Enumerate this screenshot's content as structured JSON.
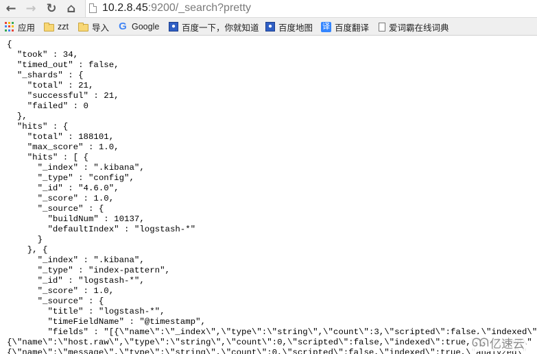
{
  "browser": {
    "nav": {
      "back_icon": "←",
      "forward_icon": "→",
      "reload_icon": "↻",
      "home_icon": "⌂"
    },
    "url": {
      "host": "10.2.8.45",
      "rest": ":9200/_search?pretty"
    },
    "bookmarks": [
      {
        "label": "应用",
        "icon": "apps-icon"
      },
      {
        "label": "zzt",
        "icon": "folder-icon"
      },
      {
        "label": "导入",
        "icon": "folder-icon"
      },
      {
        "label": "Google",
        "icon": "google-icon",
        "glyph": "G"
      },
      {
        "label": "百度一下，你就知道",
        "icon": "baidu-icon",
        "glyph": "🐾"
      },
      {
        "label": "百度地图",
        "icon": "baidu-icon",
        "glyph": "🐾"
      },
      {
        "label": "百度翻译",
        "icon": "translate-icon",
        "glyph": "译"
      },
      {
        "label": "爱词霸在线词典",
        "icon": "page-icon"
      }
    ]
  },
  "page": {
    "json_lines": [
      "{",
      "  \"took\" : 34,",
      "  \"timed_out\" : false,",
      "  \"_shards\" : {",
      "    \"total\" : 21,",
      "    \"successful\" : 21,",
      "    \"failed\" : 0",
      "  },",
      "  \"hits\" : {",
      "    \"total\" : 188101,",
      "    \"max_score\" : 1.0,",
      "    \"hits\" : [ {",
      "      \"_index\" : \".kibana\",",
      "      \"_type\" : \"config\",",
      "      \"_id\" : \"4.6.0\",",
      "      \"_score\" : 1.0,",
      "      \"_source\" : {",
      "        \"buildNum\" : 10137,",
      "        \"defaultIndex\" : \"logstash-*\"",
      "      }",
      "    }, {",
      "      \"_index\" : \".kibana\",",
      "      \"_type\" : \"index-pattern\",",
      "      \"_id\" : \"logstash-*\",",
      "      \"_score\" : 1.0,",
      "      \"_source\" : {",
      "        \"title\" : \"logstash-*\",",
      "        \"timeFieldName\" : \"@timestamp\",",
      "        \"fields\" : \"[{\\\"name\\\":\\\"_index\\\",\\\"type\\\":\\\"string\\\",\\\"count\\\":3,\\\"scripted\\\":false,\\\"indexed\\\":false,\\\"analyzed\\\"",
      "{\\\"name\\\":\\\"host.raw\\\",\\\"type\\\":\\\"string\\\",\\\"count\\\":0,\\\"scripted\\\":false,\\\"indexed\\\":true,\\\"analyzed\\\"",
      "{\\\"name\\\":\\\"message\\\",\\\"type\\\":\\\"string\\\",\\\"count\\\":0,\\\"scripted\\\":false,\\\"indexed\\\":true,\\\"analyzed\\\""
    ]
  },
  "watermark": {
    "logo": "ᘏᘏ",
    "text": "亿速云"
  }
}
